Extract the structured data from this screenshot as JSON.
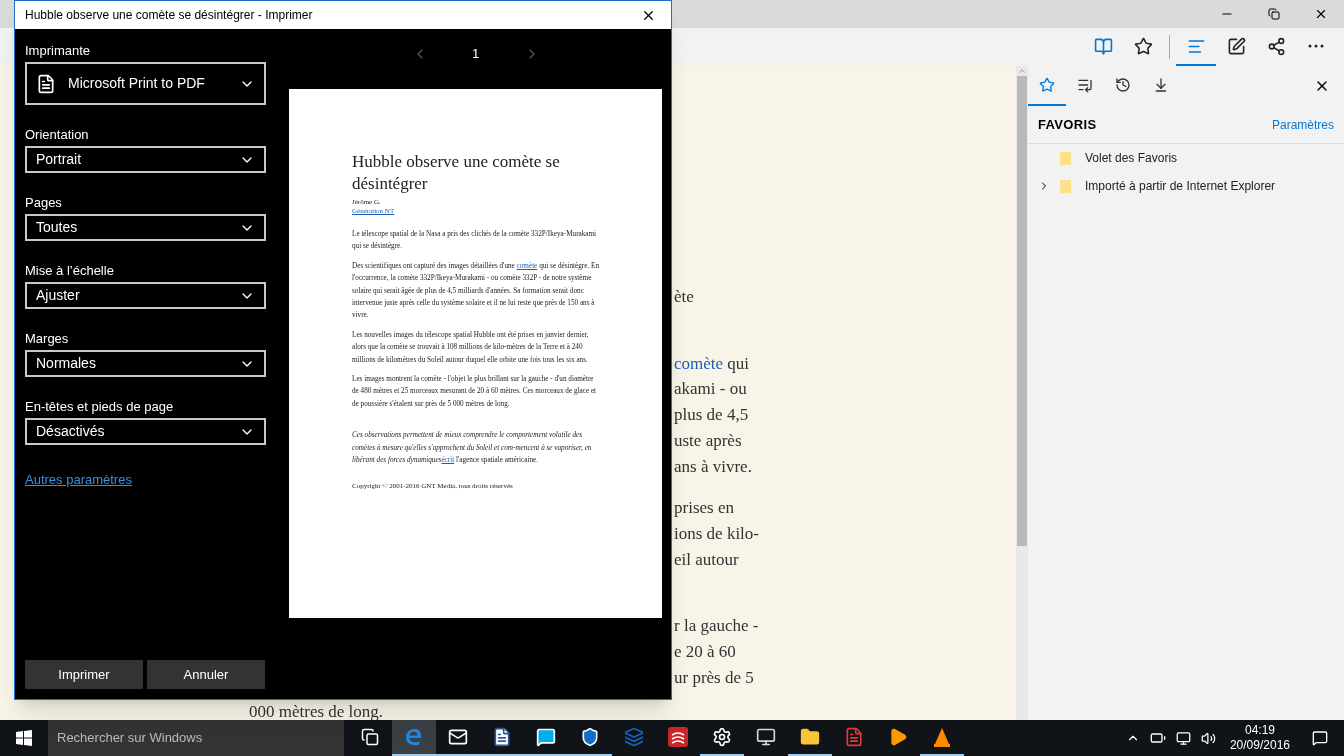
{
  "browser": {
    "toolbar": [
      {
        "kind": "reading_view",
        "selected": false
      },
      {
        "kind": "favorite",
        "selected": false
      },
      {
        "kind": "hub",
        "selected": true
      },
      {
        "kind": "web_note",
        "selected": false
      },
      {
        "kind": "share",
        "selected": false
      },
      {
        "kind": "more",
        "selected": false
      }
    ],
    "article": {
      "paragraphs": [
        [
          {
            "text": "ète"
          }
        ],
        [
          {
            "link": "comète",
            "text": " qui"
          },
          {
            "text": "akami - ou"
          },
          {
            "text": "plus de 4,5"
          },
          {
            "text": "uste après"
          },
          {
            "text": "ans à vivre."
          }
        ],
        [
          {
            "text": "prises en"
          },
          {
            "text": "ions de kilo-"
          },
          {
            "text": "eil autour"
          }
        ],
        [
          {
            "text": "r la gauche -"
          },
          {
            "text": "e 20 à 60"
          },
          {
            "text": "ur près de 5"
          }
        ]
      ],
      "last_line": "000 mètres de long."
    },
    "hub": {
      "tabs": [
        {
          "kind": "favorites",
          "selected": true
        },
        {
          "kind": "reading_list",
          "selected": false
        },
        {
          "kind": "history",
          "selected": false
        },
        {
          "kind": "downloads",
          "selected": false
        }
      ],
      "title": "FAVORIS",
      "settings_link": "Paramètres",
      "items": [
        {
          "label": "Volet des Favoris",
          "expandable": false
        },
        {
          "label": "Importé à partir de Internet Explorer",
          "expandable": true
        }
      ]
    }
  },
  "print_dialog": {
    "title": "Hubble observe une comète se désintégrer - Imprimer",
    "fields": [
      {
        "label": "Imprimante",
        "value": "Microsoft Print to PDF",
        "kind": "printer"
      },
      {
        "label": "Orientation",
        "value": "Portrait",
        "kind": "select"
      },
      {
        "label": "Pages",
        "value": "Toutes",
        "kind": "select"
      },
      {
        "label": "Mise à l’échelle",
        "value": "Ajuster",
        "kind": "select"
      },
      {
        "label": "Marges",
        "value": "Normales",
        "kind": "select"
      },
      {
        "label": "En-têtes et pieds de page",
        "value": "Désactivés",
        "kind": "select"
      }
    ],
    "more_settings_link": "Autres paramètres",
    "buttons": [
      "Imprimer",
      "Annuler"
    ],
    "pager": {
      "page": "1",
      "prev_enabled": false,
      "next_enabled": false
    },
    "preview": {
      "title": "Hubble observe une comète se désintégrer",
      "author": "Jérôme G.",
      "source": "Génération NT",
      "paragraphs": [
        {
          "kind": "body",
          "parts": [
            {
              "text": "Le télescope spatial de la Nasa a pris des clichés de la comète 332P/Ikeya-Murakami qui se désintègre.",
              "link": false
            }
          ]
        },
        {
          "kind": "body",
          "parts": [
            {
              "text": "Des scientifiques ont capturé des images détaillées d'une ",
              "link": false
            },
            {
              "text": "comète",
              "link": true
            },
            {
              "text": " qui se désintègre. En l'occurrence, la comète 332P/Ikeya-Murakami - ou comète 332P - de notre système solaire qui serait âgée de plus de 4,5 milliards d'années. Sa formation serait donc intervenue juste après celle du système solaire et il ne lui reste que près de 150 ans à vivre.",
              "link": false
            }
          ]
        },
        {
          "kind": "body",
          "parts": [
            {
              "text": "Les nouvelles images du télescope spatial Hubble ont été prises en janvier dernier, alors que la comète se trouvait à 108 millions de kilo-mètres de la Terre et à 240 millions de kilomètres du Soleil autour duquel elle orbite une fois tous les six ans.",
              "link": false
            }
          ]
        },
        {
          "kind": "body",
          "parts": [
            {
              "text": "Les images montrent la comète - l'objet le plus brillant sur la gauche - d'un diamètre de 480 mètres et 25 morceaux mesurant de 20 à 60 mètres. Ces morceaux de glace et de poussière s'étalent sur près de 5 000 mètres de long.",
              "link": false
            }
          ]
        },
        {
          "kind": "note",
          "parts": [
            {
              "text": "*Ces observations permettent de mieux comprendre le comportement volatile des comètes à mesure qu'elles s'approchent du Soleil et com-mencent à se vaporiser, en libérant des forces dynamiques*",
              "link": false
            },
            {
              "text": "écrit",
              "link": true
            },
            {
              "text": " l'agence spatiale américaine.",
              "link": false
            }
          ]
        }
      ],
      "copyright": "Copyright © 2001-2016 GNT Media, tous droits réservés"
    }
  },
  "taskbar": {
    "search_placeholder": "Rechercher sur Windows",
    "apps": [
      {
        "kind": "task_view",
        "running": false,
        "active": false
      },
      {
        "kind": "edge",
        "running": true,
        "active": true
      },
      {
        "kind": "mail",
        "running": true,
        "active": false
      },
      {
        "kind": "word",
        "running": true,
        "active": false
      },
      {
        "kind": "skype",
        "running": true,
        "active": false
      },
      {
        "kind": "defender",
        "running": true,
        "active": false
      },
      {
        "kind": "malware",
        "running": false,
        "active": false
      },
      {
        "kind": "radio",
        "running": false,
        "active": false
      },
      {
        "kind": "settings",
        "running": true,
        "active": false
      },
      {
        "kind": "monitor",
        "running": false,
        "active": false
      },
      {
        "kind": "explorer",
        "running": true,
        "active": false
      },
      {
        "kind": "acrobat",
        "running": false,
        "active": false
      },
      {
        "kind": "player",
        "running": false,
        "active": false
      },
      {
        "kind": "vlc",
        "running": true,
        "active": false
      }
    ],
    "time": "04:19",
    "date": "20/09/2016"
  }
}
